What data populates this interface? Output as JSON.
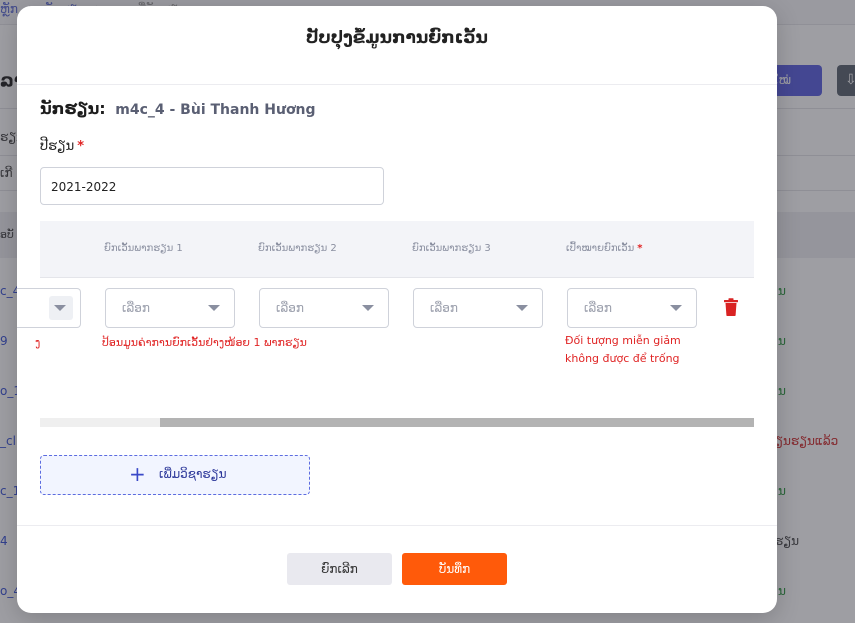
{
  "background": {
    "breadcrumb": [
      "ຫຼັກ",
      ">",
      "ນັກຮຽນ",
      ">",
      "ລາຍຊື່ນັກຮຽນ"
    ],
    "page_title": "ລາຍຊື່",
    "new_button": "ໃໝ່",
    "rows": [
      {
        "left": "ຮຽນ",
        "right": ""
      },
      {
        "left": "ເກີ",
        "right": ""
      },
      {
        "left": "ອບັ",
        "right": ""
      },
      {
        "left": "c_4",
        "right": "ນ"
      },
      {
        "left": "9",
        "right": "ນ"
      },
      {
        "left": "o_1",
        "right": "ນ"
      },
      {
        "left": "_cl",
        "right": "ຽນຮຽນແລ້ວ"
      },
      {
        "left": "c_1",
        "right": "ນ"
      },
      {
        "left": "4",
        "right": "ຮຽນ"
      },
      {
        "left": "o_4",
        "right": "ນ"
      }
    ]
  },
  "modal": {
    "title": "ປັບປຸງຂໍ້ມູນການຍົກເວັ້ນ",
    "student_label": "ນັກຮຽນ:",
    "student_value": "m4c_4 - Bùi Thanh Hương",
    "year_label": "ປີຮຽນ",
    "year_required": "*",
    "year_value": "2021-2022",
    "columns": [
      {
        "label": "ຍົກເວັ້ນພາກຮຽນ 1"
      },
      {
        "label": "ຍົກເວັ້ນພາກຮຽນ 2"
      },
      {
        "label": "ຍົກເວັ້ນພາກຮຽນ 3"
      },
      {
        "label": "ເປົ້າໝາຍຍົກເວັ້ນ",
        "required": "*"
      }
    ],
    "select_placeholder": "ເລືອກ",
    "errors": {
      "cut": "ງ",
      "semester": "ປ້ອນມູນຄ່າການຍົກເວັ້ນຢ່າງໜ້ອຍ 1 ພາກຮຽນ",
      "target_line1": "Đối tượng miễn giảm",
      "target_line2": "không được để trống"
    },
    "scroll": {
      "thumb_position": 0.17
    },
    "add_button": "ເພີ່ມວິຊາຮຽນ",
    "cancel_button": "ຍົກເລີກ",
    "save_button": "ບັນທຶກ"
  },
  "colors": {
    "primary": "#5b62e0",
    "save": "#ff5a0a",
    "error": "#e02424",
    "link": "#3b54d8",
    "success": "#2c9a3f"
  }
}
